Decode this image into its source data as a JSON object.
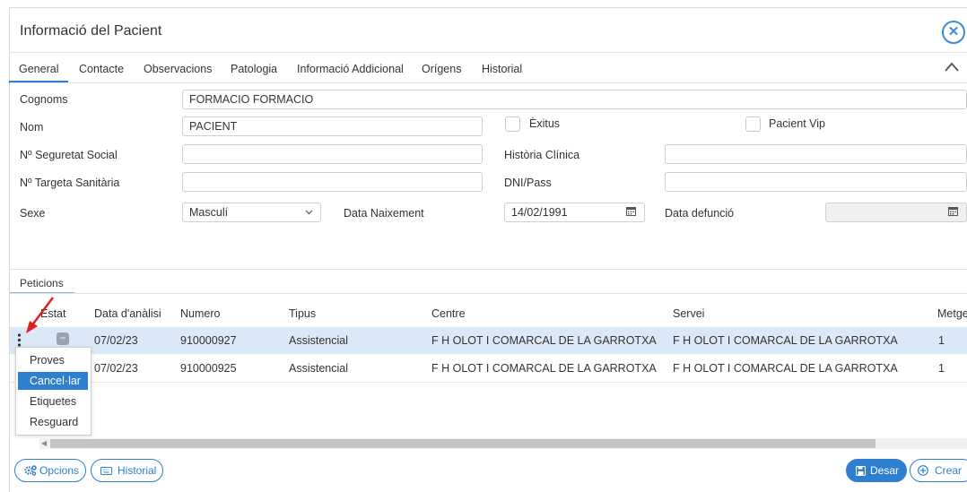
{
  "dialog": {
    "title": "Informació del Pacient",
    "close_glyph": "✕"
  },
  "tabs": [
    "General",
    "Contacte",
    "Observacions",
    "Patologia",
    "Informació Addicional",
    "Orígens",
    "Historial"
  ],
  "form": {
    "cognoms_label": "Cognoms",
    "cognoms_value": "FORMACIO FORMACIO",
    "nom_label": "Nom",
    "nom_value": "PACIENT",
    "exitus_label": "Èxitus",
    "vip_label": "Pacient Vip",
    "nss_label": "Nº Seguretat Social",
    "nss_value": "",
    "historia_label": "Història Clínica",
    "historia_value": "",
    "targeta_label": "Nº Targeta Sanitària",
    "targeta_value": "",
    "dni_label": "DNI/Pass",
    "dni_value": "",
    "sexe_label": "Sexe",
    "sexe_value": "Masculí",
    "naixement_label": "Data Naixement",
    "naixement_value": "14/02/1991",
    "defuncio_label": "Data defunció",
    "defuncio_value": ""
  },
  "peticions": {
    "tab_label": "Peticions",
    "columns": [
      "Estat",
      "Data d'anàlisi",
      "Numero",
      "Tipus",
      "Centre",
      "Servei",
      "Metge"
    ],
    "rows": [
      [
        "07/02/23",
        "910000927",
        "Assistencial",
        "F H OLOT I COMARCAL DE LA GARROTXA",
        "F H OLOT I COMARCAL DE LA GARROTXA",
        "1"
      ],
      [
        "07/02/23",
        "910000925",
        "Assistencial",
        "F H OLOT I COMARCAL DE LA GARROTXA",
        "F H OLOT I COMARCAL DE LA GARROTXA",
        "1"
      ]
    ],
    "context_menu": [
      "Proves",
      "Cancel·lar",
      "Etiquetes",
      "Resguard"
    ],
    "highlighted_menu_item": "Cancel·lar"
  },
  "footer": {
    "opcions": "Opcions",
    "historial": "Historial",
    "desar": "Desar",
    "crear": "Crear"
  },
  "colors": {
    "accent": "#2f7fd1",
    "selected_row": "#dbe8f7",
    "annotation_arrow": "#e02020"
  }
}
